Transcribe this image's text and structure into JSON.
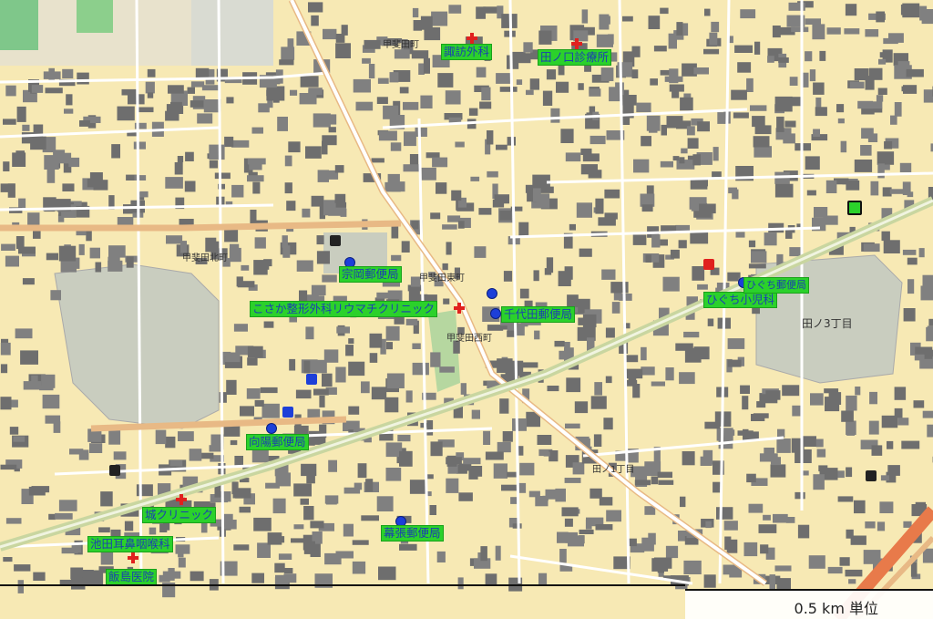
{
  "map": {
    "background_color": "#f7e9b4",
    "road_color": "#ffffff",
    "major_road_color": "#e8c89a",
    "building_color": "#6e6e6e",
    "school_color": "#c9cdbf",
    "railway_color": "#c9d6a0",
    "park_color": "#8fd08f",
    "highway_color": "#e87a4a"
  },
  "green_labels": [
    {
      "id": "suwa-geka",
      "text": "諏訪外科",
      "icon": "cross"
    },
    {
      "id": "tanokuchi",
      "text": "田ノ口診療所",
      "icon": "cross"
    },
    {
      "id": "kosaka",
      "text": "こさか整形外科リウマチクリニック",
      "icon": "cross"
    },
    {
      "id": "higuchi",
      "text": "ひぐち小児科",
      "icon": "cross"
    },
    {
      "id": "sakaki-clinic",
      "text": "城クリニック",
      "icon": "cross"
    },
    {
      "id": "ikeda",
      "text": "池田耳鼻咽喉科",
      "icon": "cross"
    },
    {
      "id": "iijima",
      "text": "飯島医院",
      "icon": "cross"
    },
    {
      "id": "post-1",
      "text": "宗岡郵便局",
      "icon": "dot"
    },
    {
      "id": "post-2",
      "text": "千代田郵便局",
      "icon": "dot"
    },
    {
      "id": "post-3",
      "text": "ひぐち郵便局",
      "icon": "dot"
    },
    {
      "id": "post-4",
      "text": "向陽郵便局",
      "icon": "dot"
    },
    {
      "id": "post-5",
      "text": "幕張郵便局",
      "icon": "dot"
    }
  ],
  "area_labels": [
    {
      "id": "kofuda-higashi",
      "text": "甲斐田東町"
    },
    {
      "id": "kofuda-nishi",
      "text": "甲斐田西町"
    },
    {
      "id": "tanokuchi-3",
      "text": "田ノ3丁目"
    },
    {
      "id": "tanokuchi-1",
      "text": "田ノ1丁目"
    },
    {
      "id": "kofuda-kita",
      "text": "甲斐田北町"
    },
    {
      "id": "kofuda-cho",
      "text": "甲斐田町"
    }
  ],
  "scale": {
    "text": "0.5 km 単位"
  }
}
